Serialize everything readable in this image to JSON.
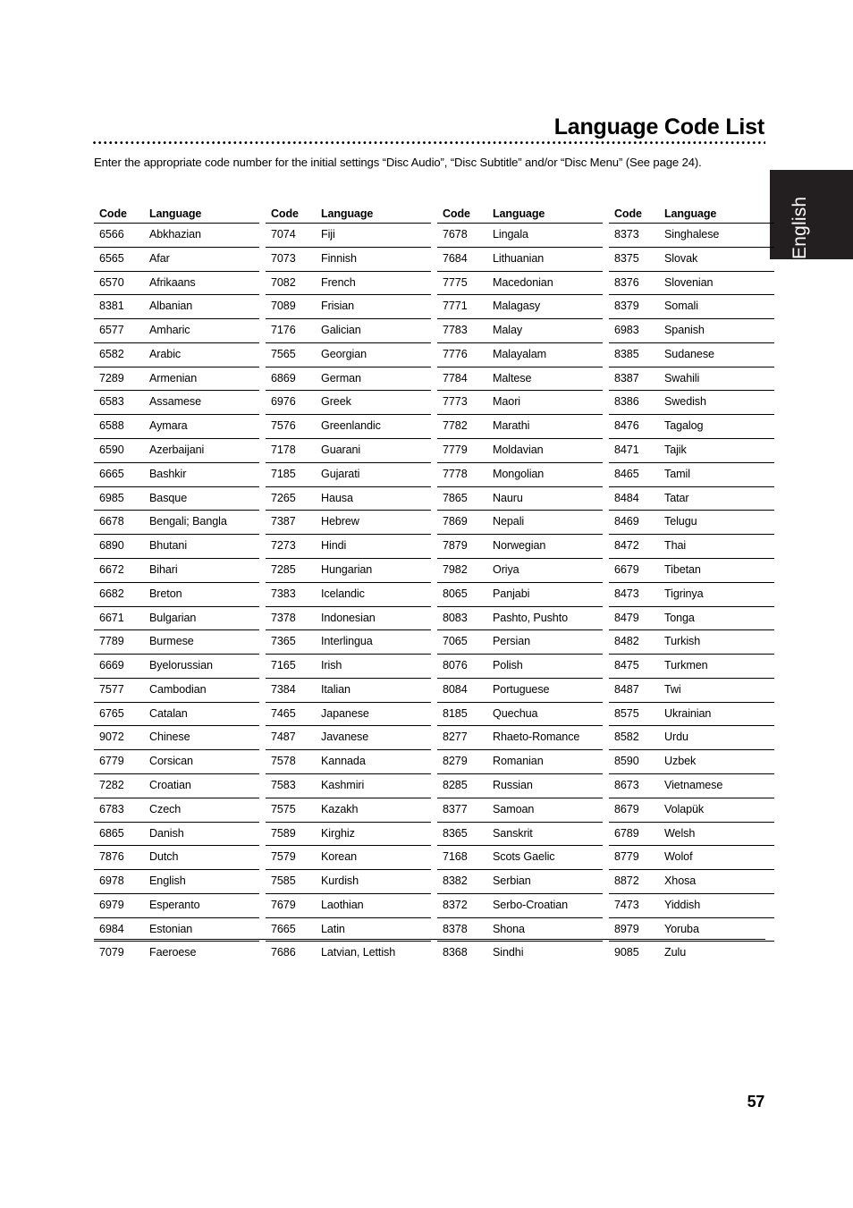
{
  "page": {
    "title": "Language Code List",
    "intro": "Enter the appropriate code number for the initial settings “Disc Audio”, “Disc Subtitle” and/or “Disc Menu” (See page 24).",
    "side_tab_label": "English",
    "page_number": "57",
    "accent_color": "#231f20",
    "rule_color": "#000000"
  },
  "table": {
    "headers": [
      "Code",
      "Language"
    ],
    "columns": [
      {
        "rows": [
          [
            "6566",
            "Abkhazian"
          ],
          [
            "6565",
            "Afar"
          ],
          [
            "6570",
            "Afrikaans"
          ],
          [
            "8381",
            "Albanian"
          ],
          [
            "6577",
            "Amharic"
          ],
          [
            "6582",
            "Arabic"
          ],
          [
            "7289",
            "Armenian"
          ],
          [
            "6583",
            "Assamese"
          ],
          [
            "6588",
            "Aymara"
          ],
          [
            "6590",
            "Azerbaijani"
          ],
          [
            "6665",
            "Bashkir"
          ],
          [
            "6985",
            "Basque"
          ],
          [
            "6678",
            "Bengali; Bangla"
          ],
          [
            "6890",
            "Bhutani"
          ],
          [
            "6672",
            "Bihari"
          ],
          [
            "6682",
            "Breton"
          ],
          [
            "6671",
            "Bulgarian"
          ],
          [
            "7789",
            "Burmese"
          ],
          [
            "6669",
            "Byelorussian"
          ],
          [
            "7577",
            "Cambodian"
          ],
          [
            "6765",
            "Catalan"
          ],
          [
            "9072",
            "Chinese"
          ],
          [
            "6779",
            "Corsican"
          ],
          [
            "7282",
            "Croatian"
          ],
          [
            "6783",
            "Czech"
          ],
          [
            "6865",
            "Danish"
          ],
          [
            "7876",
            "Dutch"
          ],
          [
            "6978",
            "English"
          ],
          [
            "6979",
            "Esperanto"
          ],
          [
            "6984",
            "Estonian"
          ],
          [
            "7079",
            "Faeroese"
          ]
        ]
      },
      {
        "rows": [
          [
            "7074",
            "Fiji"
          ],
          [
            "7073",
            "Finnish"
          ],
          [
            "7082",
            "French"
          ],
          [
            "7089",
            "Frisian"
          ],
          [
            "7176",
            "Galician"
          ],
          [
            "7565",
            "Georgian"
          ],
          [
            "6869",
            "German"
          ],
          [
            "6976",
            "Greek"
          ],
          [
            "7576",
            "Greenlandic"
          ],
          [
            "7178",
            "Guarani"
          ],
          [
            "7185",
            "Gujarati"
          ],
          [
            "7265",
            "Hausa"
          ],
          [
            "7387",
            "Hebrew"
          ],
          [
            "7273",
            "Hindi"
          ],
          [
            "7285",
            "Hungarian"
          ],
          [
            "7383",
            "Icelandic"
          ],
          [
            "7378",
            "Indonesian"
          ],
          [
            "7365",
            "Interlingua"
          ],
          [
            "7165",
            "Irish"
          ],
          [
            "7384",
            "Italian"
          ],
          [
            "7465",
            "Japanese"
          ],
          [
            "7487",
            "Javanese"
          ],
          [
            "7578",
            "Kannada"
          ],
          [
            "7583",
            "Kashmiri"
          ],
          [
            "7575",
            "Kazakh"
          ],
          [
            "7589",
            "Kirghiz"
          ],
          [
            "7579",
            "Korean"
          ],
          [
            "7585",
            "Kurdish"
          ],
          [
            "7679",
            "Laothian"
          ],
          [
            "7665",
            "Latin"
          ],
          [
            "7686",
            "Latvian, Lettish"
          ]
        ]
      },
      {
        "rows": [
          [
            "7678",
            "Lingala"
          ],
          [
            "7684",
            "Lithuanian"
          ],
          [
            "7775",
            "Macedonian"
          ],
          [
            "7771",
            "Malagasy"
          ],
          [
            "7783",
            "Malay"
          ],
          [
            "7776",
            "Malayalam"
          ],
          [
            "7784",
            "Maltese"
          ],
          [
            "7773",
            "Maori"
          ],
          [
            "7782",
            "Marathi"
          ],
          [
            "7779",
            "Moldavian"
          ],
          [
            "7778",
            "Mongolian"
          ],
          [
            "7865",
            "Nauru"
          ],
          [
            "7869",
            "Nepali"
          ],
          [
            "7879",
            "Norwegian"
          ],
          [
            "7982",
            "Oriya"
          ],
          [
            "8065",
            "Panjabi"
          ],
          [
            "8083",
            "Pashto, Pushto"
          ],
          [
            "7065",
            "Persian"
          ],
          [
            "8076",
            "Polish"
          ],
          [
            "8084",
            "Portuguese"
          ],
          [
            "8185",
            "Quechua"
          ],
          [
            "8277",
            "Rhaeto-Romance"
          ],
          [
            "8279",
            "Romanian"
          ],
          [
            "8285",
            "Russian"
          ],
          [
            "8377",
            "Samoan"
          ],
          [
            "8365",
            "Sanskrit"
          ],
          [
            "7168",
            "Scots Gaelic"
          ],
          [
            "8382",
            "Serbian"
          ],
          [
            "8372",
            "Serbo-Croatian"
          ],
          [
            "8378",
            "Shona"
          ],
          [
            "8368",
            "Sindhi"
          ]
        ]
      },
      {
        "rows": [
          [
            "8373",
            "Singhalese"
          ],
          [
            "8375",
            "Slovak"
          ],
          [
            "8376",
            "Slovenian"
          ],
          [
            "8379",
            "Somali"
          ],
          [
            "6983",
            "Spanish"
          ],
          [
            "8385",
            "Sudanese"
          ],
          [
            "8387",
            "Swahili"
          ],
          [
            "8386",
            "Swedish"
          ],
          [
            "8476",
            "Tagalog"
          ],
          [
            "8471",
            "Tajik"
          ],
          [
            "8465",
            "Tamil"
          ],
          [
            "8484",
            "Tatar"
          ],
          [
            "8469",
            "Telugu"
          ],
          [
            "8472",
            "Thai"
          ],
          [
            "6679",
            "Tibetan"
          ],
          [
            "8473",
            "Tigrinya"
          ],
          [
            "8479",
            "Tonga"
          ],
          [
            "8482",
            "Turkish"
          ],
          [
            "8475",
            "Turkmen"
          ],
          [
            "8487",
            "Twi"
          ],
          [
            "8575",
            "Ukrainian"
          ],
          [
            "8582",
            "Urdu"
          ],
          [
            "8590",
            "Uzbek"
          ],
          [
            "8673",
            "Vietnamese"
          ],
          [
            "8679",
            "Volapük"
          ],
          [
            "6789",
            "Welsh"
          ],
          [
            "8779",
            "Wolof"
          ],
          [
            "8872",
            "Xhosa"
          ],
          [
            "7473",
            "Yiddish"
          ],
          [
            "8979",
            "Yoruba"
          ],
          [
            "9085",
            "Zulu"
          ]
        ]
      }
    ]
  }
}
